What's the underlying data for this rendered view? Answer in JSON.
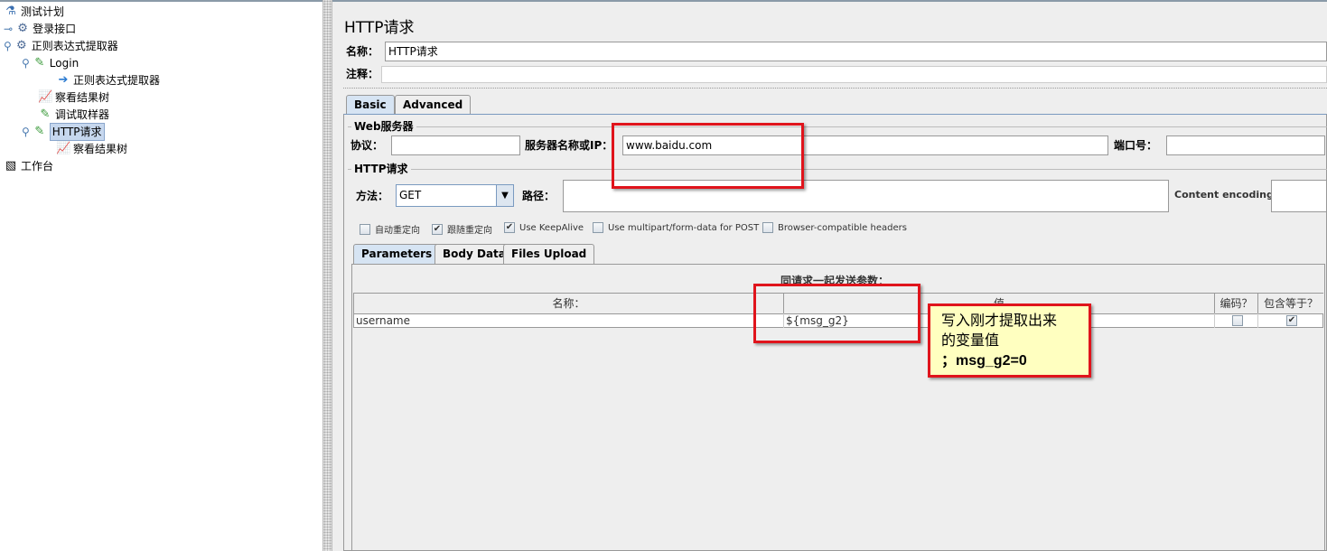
{
  "tree": [
    {
      "label": "测试计划",
      "icon": "flask-icon"
    },
    {
      "label": "登录接口",
      "icon": "gear-icon"
    },
    {
      "label": "正则表达式提取器",
      "icon": "gear-icon"
    },
    {
      "label": "Login",
      "icon": "pipette-icon"
    },
    {
      "label": "正则表达式提取器",
      "icon": "extractor-icon"
    },
    {
      "label": "察看结果树",
      "icon": "chart-icon"
    },
    {
      "label": "调试取样器",
      "icon": "pipette-icon"
    },
    {
      "label": "HTTP请求",
      "icon": "pipette-icon",
      "selected": true
    },
    {
      "label": "察看结果树",
      "icon": "chart-icon"
    },
    {
      "label": "工作台",
      "icon": "workbench-icon"
    }
  ],
  "panel": {
    "title": "HTTP请求",
    "name_label": "名称：",
    "name_value": "HTTP请求",
    "comment_label": "注释：",
    "comment_value": "",
    "tabs": [
      "Basic",
      "Advanced"
    ],
    "web_server": {
      "group": "Web服务器",
      "protocol_label": "协议：",
      "protocol_value": "",
      "server_label": "服务器名称或IP：",
      "server_value": "www.baidu.com",
      "port_label": "端口号：",
      "port_value": ""
    },
    "http": {
      "group": "HTTP请求",
      "method_label": "方法：",
      "method_value": "GET",
      "path_label": "路径：",
      "path_value": "",
      "encoding_label": "Content encoding:",
      "encoding_value": ""
    },
    "checkboxes": [
      {
        "label": "自动重定向",
        "checked": false
      },
      {
        "label": "跟随重定向",
        "checked": true
      },
      {
        "label": "Use KeepAlive",
        "checked": true
      },
      {
        "label": "Use multipart/form-data for POST",
        "checked": false
      },
      {
        "label": "Browser-compatible headers",
        "checked": false
      }
    ],
    "subtabs": [
      "Parameters",
      "Body Data",
      "Files Upload"
    ],
    "params_title": "同请求一起发送参数：",
    "columns": [
      "名称：",
      "值",
      "编码？",
      "包含等于？"
    ],
    "rows": [
      {
        "name": "username",
        "value": "${msg_g2}",
        "encode": false,
        "include_equals": true
      }
    ]
  },
  "annotation": {
    "line1": "写入刚才提取出来",
    "line2": "的变量值",
    "line3": "；msg_g2=0",
    "bg": "#ffffc0",
    "border": "#e0141c"
  }
}
